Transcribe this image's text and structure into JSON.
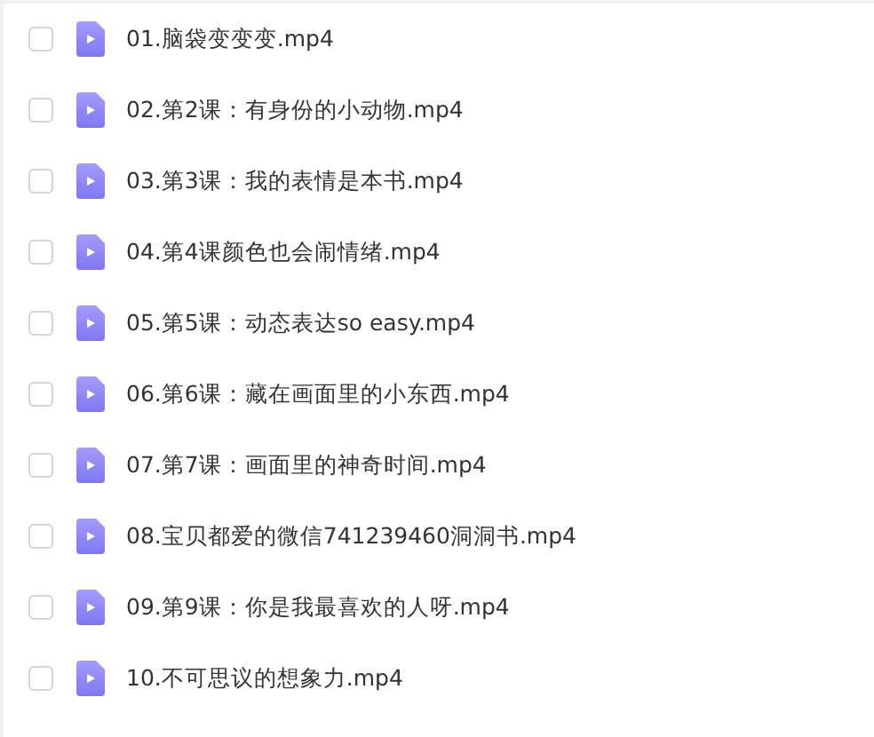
{
  "files": [
    {
      "name": "01.脑袋变变变.mp4",
      "checked": false
    },
    {
      "name": "02.第2课：有身份的小动物.mp4",
      "checked": false
    },
    {
      "name": "03.第3课：我的表情是本书.mp4",
      "checked": false
    },
    {
      "name": "04.第4课颜色也会闹情绪.mp4",
      "checked": false
    },
    {
      "name": "05.第5课：动态表达so easy.mp4",
      "checked": false
    },
    {
      "name": "06.第6课：藏在画面里的小东西.mp4",
      "checked": false
    },
    {
      "name": "07.第7课：画面里的神奇时间.mp4",
      "checked": false
    },
    {
      "name": "08.宝贝都爱的微信741239460洞洞书.mp4",
      "checked": false
    },
    {
      "name": "09.第9课：你是我最喜欢的人呀.mp4",
      "checked": false
    },
    {
      "name": "10.不可思议的想象力.mp4",
      "checked": false
    }
  ]
}
